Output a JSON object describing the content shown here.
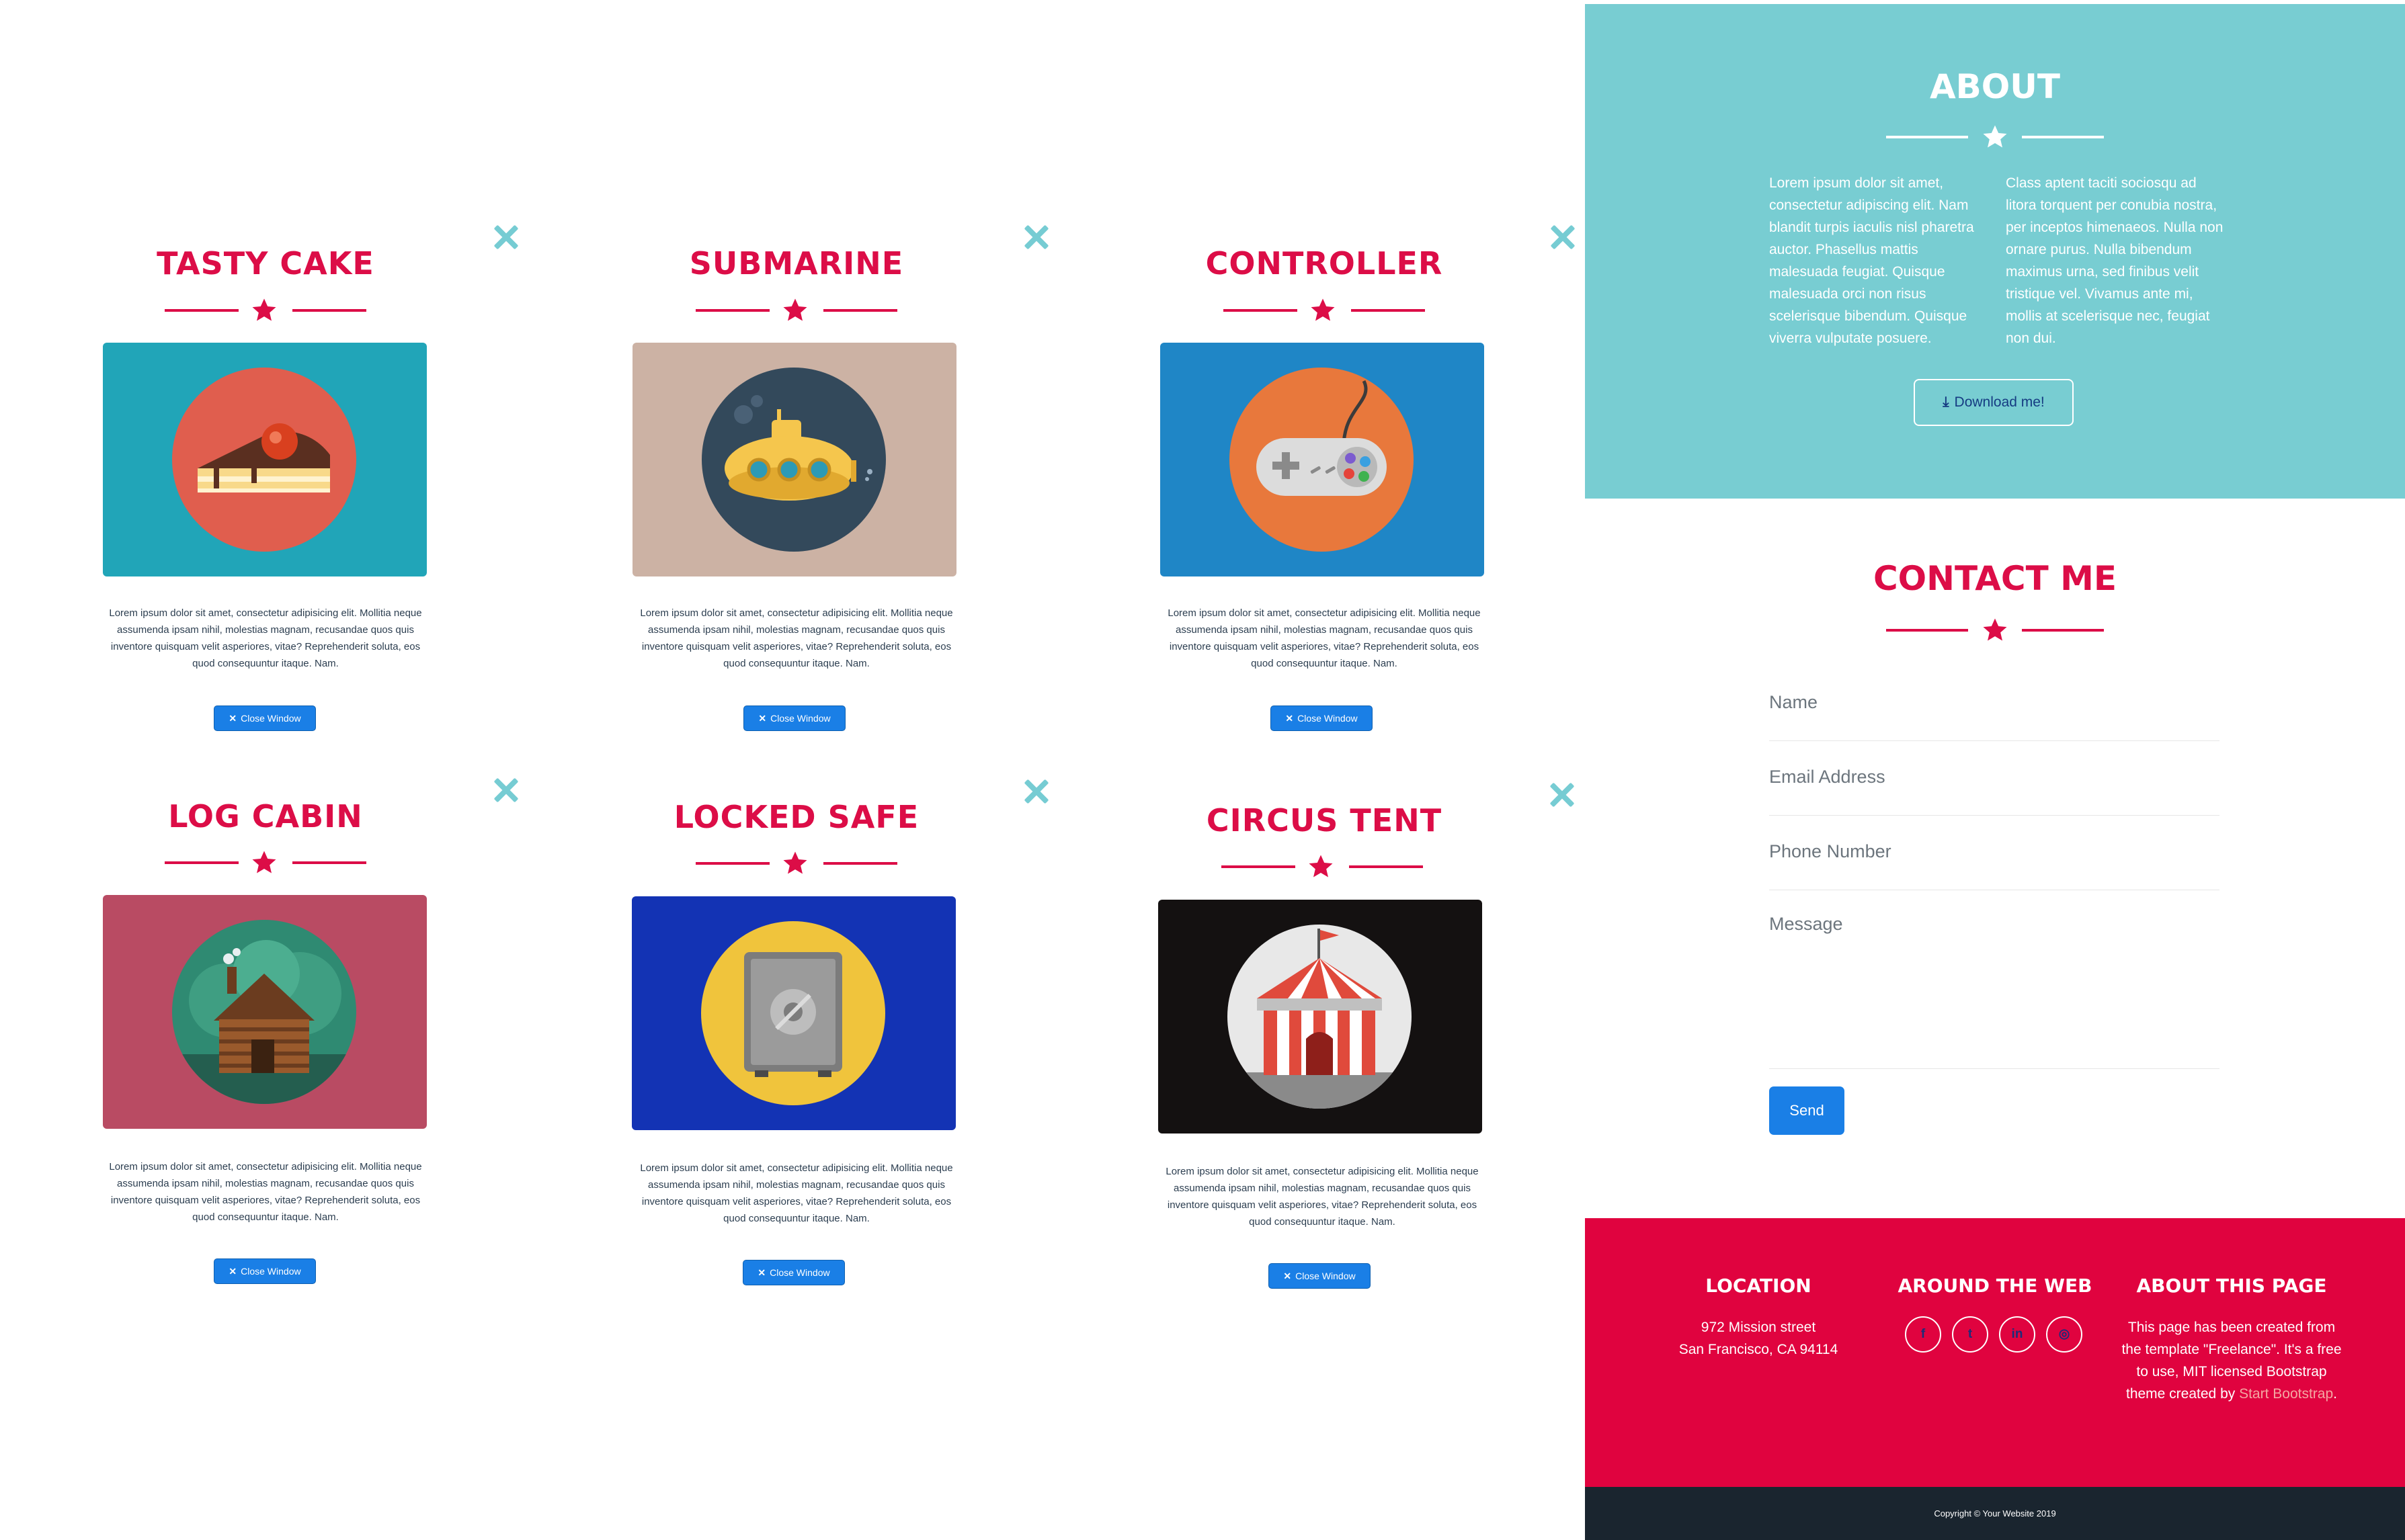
{
  "colors": {
    "brand_red": "#dc0d47",
    "teal": "#78cdd2",
    "button_blue": "#1a7fe6",
    "dark": "#1a252f"
  },
  "modals": [
    {
      "title": "TASTY CAKE",
      "image": "cake-illustration",
      "text": "Lorem ipsum dolor sit amet, consectetur adipisicing elit. Mollitia neque assumenda ipsam nihil, molestias magnam, recusandae quos quis inventore quisquam velit asperiores, vitae? Reprehenderit soluta, eos quod consequuntur itaque. Nam.",
      "close_label": "Close Window"
    },
    {
      "title": "SUBMARINE",
      "image": "submarine-illustration",
      "text": "Lorem ipsum dolor sit amet, consectetur adipisicing elit. Mollitia neque assumenda ipsam nihil, molestias magnam, recusandae quos quis inventore quisquam velit asperiores, vitae? Reprehenderit soluta, eos quod consequuntur itaque. Nam.",
      "close_label": "Close Window"
    },
    {
      "title": "CONTROLLER",
      "image": "game-controller-illustration",
      "text": "Lorem ipsum dolor sit amet, consectetur adipisicing elit. Mollitia neque assumenda ipsam nihil, molestias magnam, recusandae quos quis inventore quisquam velit asperiores, vitae? Reprehenderit soluta, eos quod consequuntur itaque. Nam.",
      "close_label": "Close Window"
    },
    {
      "title": "LOG CABIN",
      "image": "log-cabin-illustration",
      "text": "Lorem ipsum dolor sit amet, consectetur adipisicing elit. Mollitia neque assumenda ipsam nihil, molestias magnam, recusandae quos quis inventore quisquam velit asperiores, vitae? Reprehenderit soluta, eos quod consequuntur itaque. Nam.",
      "close_label": "Close Window"
    },
    {
      "title": "LOCKED SAFE",
      "image": "safe-illustration",
      "text": "Lorem ipsum dolor sit amet, consectetur adipisicing elit. Mollitia neque assumenda ipsam nihil, molestias magnam, recusandae quos quis inventore quisquam velit asperiores, vitae? Reprehenderit soluta, eos quod consequuntur itaque. Nam.",
      "close_label": "Close Window"
    },
    {
      "title": "CIRCUS TENT",
      "image": "circus-tent-illustration",
      "text": "Lorem ipsum dolor sit amet, consectetur adipisicing elit. Mollitia neque assumenda ipsam nihil, molestias magnam, recusandae quos quis inventore quisquam velit asperiores, vitae? Reprehenderit soluta, eos quod consequuntur itaque. Nam.",
      "close_label": "Close Window"
    }
  ],
  "about": {
    "title": "ABOUT",
    "col1": "Lorem ipsum dolor sit amet, consectetur adipiscing elit. Nam blandit turpis iaculis nisl pharetra auctor. Phasellus mattis malesuada feugiat. Quisque malesuada orci non risus scelerisque bibendum. Quisque viverra vulputate posuere.",
    "col2": "Class aptent taciti sociosqu ad litora torquent per conubia nostra, per inceptos himenaeos. Nulla non ornare purus. Nulla bibendum maximus urna, sed finibus velit tristique vel. Vivamus ante mi, mollis at scelerisque nec, feugiat non dui.",
    "download_label": "Download me!"
  },
  "contact": {
    "title": "CONTACT ME",
    "name_placeholder": "Name",
    "email_placeholder": "Email Address",
    "phone_placeholder": "Phone Number",
    "message_placeholder": "Message",
    "send_label": "Send"
  },
  "footer": {
    "location_title": "LOCATION",
    "address_line1": "972 Mission street",
    "address_line2": "San Francisco, CA 94114",
    "web_title": "AROUND THE WEB",
    "social": [
      "f",
      "t",
      "in",
      "◎"
    ],
    "social_icons": [
      "facebook-icon",
      "twitter-icon",
      "linkedin-icon",
      "dribbble-icon"
    ],
    "about_title": "ABOUT THIS PAGE",
    "about_text": "This page has been created from the template \"Freelance\". It's a free to use, MIT licensed Bootstrap theme created by",
    "about_link": "Start Bootstrap",
    "about_end": ".",
    "copyright": "Copyright © Your Website 2019"
  }
}
